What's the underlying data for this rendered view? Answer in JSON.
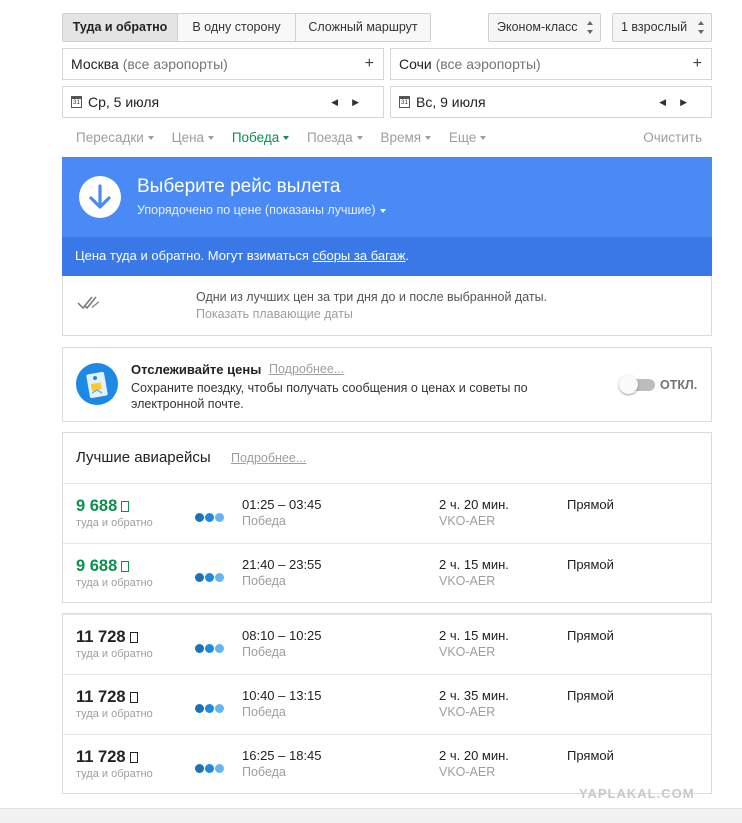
{
  "trip_tabs": [
    {
      "label": "Туда и обратно",
      "active": true
    },
    {
      "label": "В одну сторону",
      "active": false
    },
    {
      "label": "Сложный маршрут",
      "active": false
    }
  ],
  "cabin_class": "Эконом-класс",
  "passengers": "1 взрослый",
  "origin": {
    "city": "Москва",
    "detail": "(все аэропорты)"
  },
  "destination": {
    "city": "Сочи",
    "detail": "(все аэропорты)"
  },
  "depart_date": "Ср, 5 июля",
  "return_date": "Вс, 9 июля",
  "calendar_day": "31",
  "filters": [
    {
      "label": "Пересадки",
      "active": false
    },
    {
      "label": "Цена",
      "active": false
    },
    {
      "label": "Победа",
      "active": true
    },
    {
      "label": "Поезда",
      "active": false
    },
    {
      "label": "Время",
      "active": false
    },
    {
      "label": "Еще",
      "active": false
    }
  ],
  "clear_label": "Очистить",
  "header": {
    "title": "Выберите рейс вылета",
    "subtitle": "Упорядочено по цене (показаны лучшие)",
    "notice_prefix": "Цена туда и обратно. Могут взиматься ",
    "notice_link": "сборы за багаж",
    "notice_suffix": "."
  },
  "info": {
    "text": "Одни из лучших цен за три дня до и после выбранной даты.",
    "link": "Показать плавающие даты"
  },
  "tracking": {
    "title": "Отслеживайте цены",
    "more": "Подробнее...",
    "description": "Сохраните поездку, чтобы получать сообщения о ценах и советы по электронной почте.",
    "toggle_label": "ОТКЛ.",
    "enabled": false
  },
  "best": {
    "title": "Лучшие авиарейсы",
    "more": "Подробнее..."
  },
  "colors": {
    "blue": "#4a8af4",
    "blue_dark": "#3b78e7",
    "green_price": "#0d904f",
    "logo_dots": [
      "#1a73b8",
      "#1e88e5",
      "#64b5f6"
    ]
  },
  "best_flights": [
    {
      "price": "9 688",
      "price_type": "туда и обратно",
      "times": "01:25 – 03:45",
      "airline": "Победа",
      "duration": "2 ч. 20 мин.",
      "route": "VKO-AER",
      "stops": "Прямой",
      "highlight": true
    },
    {
      "price": "9 688",
      "price_type": "туда и обратно",
      "times": "21:40 – 23:55",
      "airline": "Победа",
      "duration": "2 ч. 15 мин.",
      "route": "VKO-AER",
      "stops": "Прямой",
      "highlight": true
    }
  ],
  "other_flights": [
    {
      "price": "11 728",
      "price_type": "туда и обратно",
      "times": "08:10 – 10:25",
      "airline": "Победа",
      "duration": "2 ч. 15 мин.",
      "route": "VKO-AER",
      "stops": "Прямой",
      "highlight": false
    },
    {
      "price": "11 728",
      "price_type": "туда и обратно",
      "times": "10:40 – 13:15",
      "airline": "Победа",
      "duration": "2 ч. 35 мин.",
      "route": "VKO-AER",
      "stops": "Прямой",
      "highlight": false
    },
    {
      "price": "11 728",
      "price_type": "туда и обратно",
      "times": "16:25 – 18:45",
      "airline": "Победа",
      "duration": "2 ч. 20 мин.",
      "route": "VKO-AER",
      "stops": "Прямой",
      "highlight": false
    }
  ],
  "watermark": "YAPLAKAL.COM"
}
